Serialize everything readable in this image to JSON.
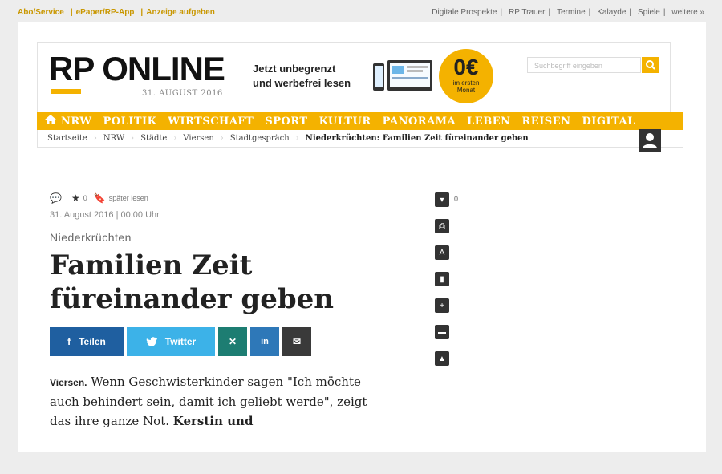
{
  "topbar": {
    "left": [
      "Abo/Service",
      "ePaper/RP-App",
      "Anzeige aufgeben"
    ],
    "right": [
      "Digitale Prospekte",
      "RP Trauer",
      "Termine",
      "Kalayde",
      "Spiele",
      "weitere »"
    ]
  },
  "header": {
    "logo": "RP ONLINE",
    "date": "31. AUGUST 2016",
    "promo_line1": "Jetzt unbegrenzt",
    "promo_line2": "und werbefrei lesen",
    "badge_big": "0€",
    "badge_small1": "im ersten",
    "badge_small2": "Monat",
    "search_placeholder": "Suchbegriff eingeben"
  },
  "nav": {
    "items": [
      "NRW",
      "POLITIK",
      "WIRTSCHAFT",
      "SPORT",
      "KULTUR",
      "PANORAMA",
      "LEBEN",
      "REISEN",
      "DIGITAL"
    ]
  },
  "breadcrumb": {
    "items": [
      "Startseite",
      "NRW",
      "Städte",
      "Viersen",
      "Stadtgespräch",
      "Niederkrüchten: Familien Zeit füreinander geben"
    ]
  },
  "article": {
    "star_count": "0",
    "read_later": "später lesen",
    "date": "31. August 2016 | 00.00 Uhr",
    "kicker": "Niederkrüchten",
    "title_line1": "Familien Zeit",
    "title_line2": "füreinander geben",
    "share_facebook": "Teilen",
    "share_twitter": "Twitter",
    "location": "Viersen.",
    "lead_text": "Wenn Geschwisterkinder sagen \"Ich möchte auch behindert sein, damit ich geliebt werde\", zeigt das ihre ganze Not.",
    "lead_bold": "Kerstin und"
  },
  "tools": {
    "comment_count": "0"
  },
  "colors": {
    "accent": "#f4b200",
    "facebook": "#1f5fa0",
    "twitter": "#3cb2e8",
    "xing": "#1d7d72",
    "linkedin": "#2e78b8"
  }
}
